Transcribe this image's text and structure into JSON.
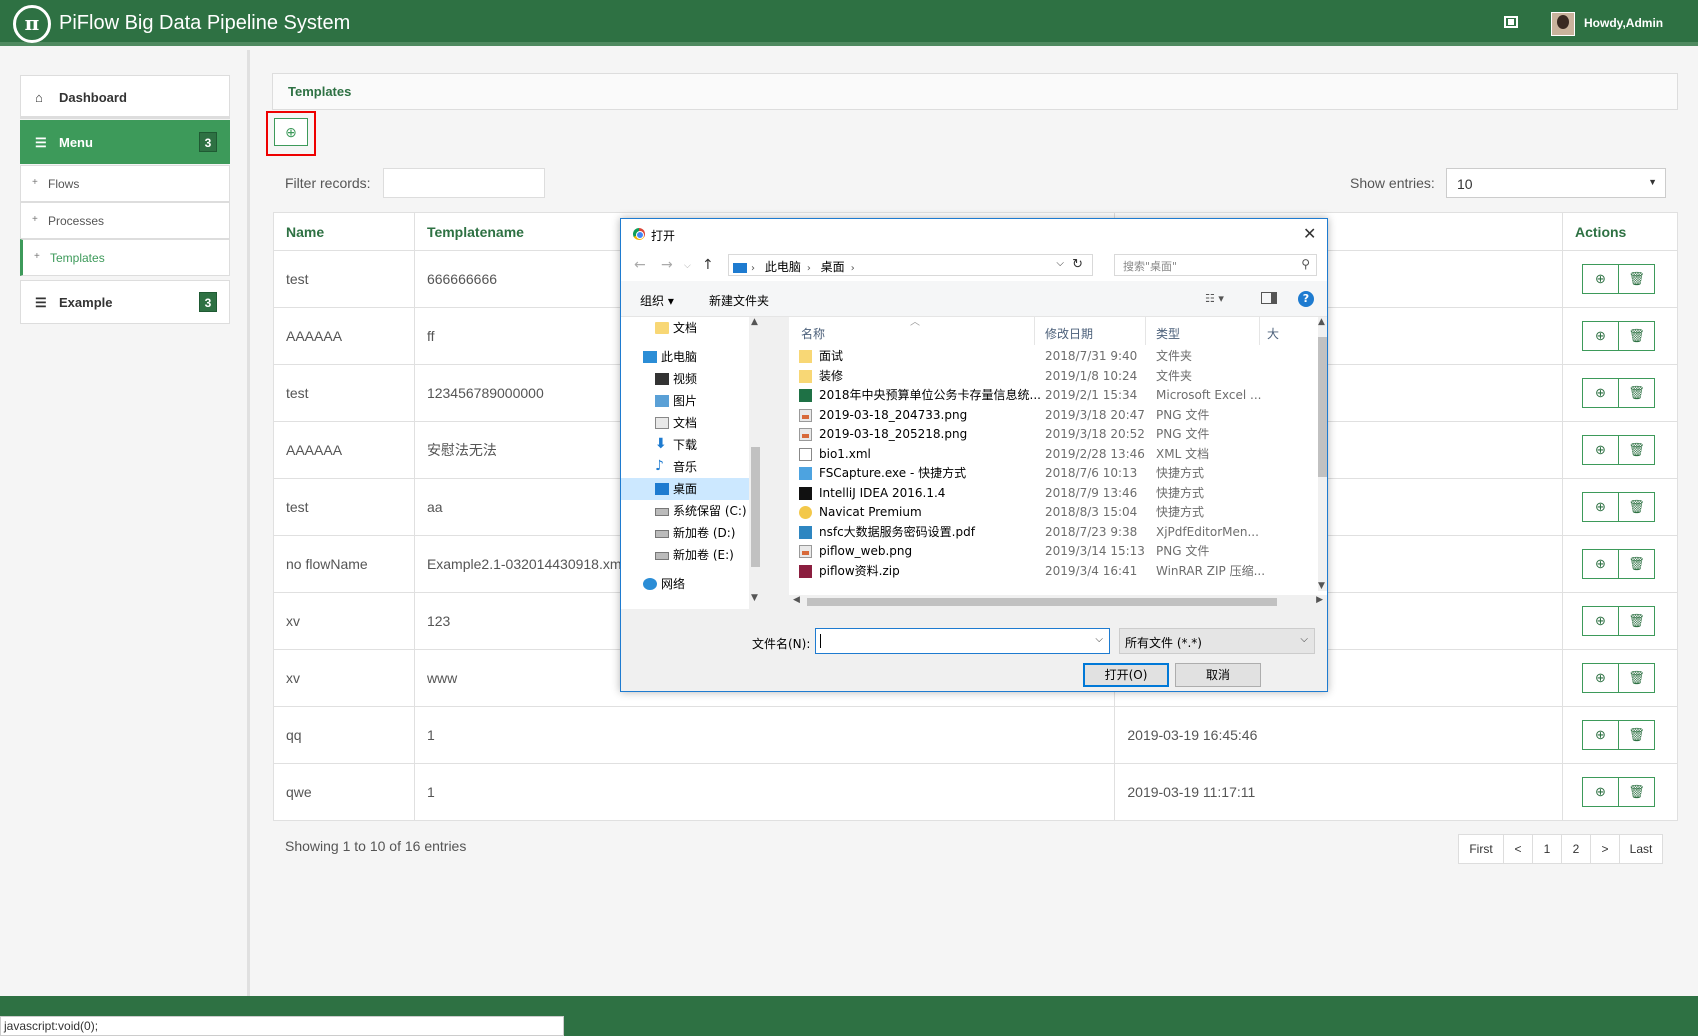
{
  "app": {
    "logo_text": "π",
    "title": "PiFlow Big Data Pipeline System",
    "user_greeting": "Howdy,Admin"
  },
  "sidebar": {
    "dashboard": "Dashboard",
    "menu": {
      "label": "Menu",
      "badge": "3"
    },
    "items": [
      {
        "label": "Flows"
      },
      {
        "label": "Processes"
      },
      {
        "label": "Templates",
        "active": true
      }
    ],
    "example": {
      "label": "Example",
      "badge": "3"
    }
  },
  "panel": {
    "title": "Templates",
    "filter_label": "Filter records:",
    "show_label": "Show entries:",
    "show_value": "10"
  },
  "table": {
    "headers": [
      "Name",
      "Templatename",
      "",
      "Actions"
    ],
    "rows": [
      {
        "name": "test",
        "templatename": "666666666",
        "date": ""
      },
      {
        "name": "AAAAAA",
        "templatename": "ff",
        "date": ""
      },
      {
        "name": "test",
        "templatename": "123456789000000",
        "date": ""
      },
      {
        "name": "AAAAAA",
        "templatename": "安慰法无法",
        "date": ""
      },
      {
        "name": "test",
        "templatename": "aa",
        "date": ""
      },
      {
        "name": "no flowName",
        "templatename": "Example2.1-032014430918.xml",
        "date": ""
      },
      {
        "name": "xv",
        "templatename": "123",
        "date": ""
      },
      {
        "name": "xv",
        "templatename": "www",
        "date": ""
      },
      {
        "name": "qq",
        "templatename": "1",
        "date": "2019-03-19 16:45:46"
      },
      {
        "name": "qwe",
        "templatename": "1",
        "date": "2019-03-19 11:17:11"
      }
    ],
    "showing": "Showing 1 to 10 of 16 entries",
    "pager": [
      "First",
      "<",
      "1",
      "2",
      ">",
      "Last"
    ]
  },
  "status_bar": "javascript:void(0);",
  "dialog": {
    "title": "打开",
    "breadcrumb": [
      "此电脑",
      "桌面"
    ],
    "search_placeholder": "搜索\"桌面\"",
    "organize": "组织 ▾",
    "new_folder": "新建文件夹",
    "tree": [
      {
        "label": "文档",
        "icon": "folder-icon",
        "indent": 1
      },
      {
        "label": "此电脑",
        "icon": "computer-icon",
        "indent": 0
      },
      {
        "label": "视频",
        "icon": "video-icon",
        "indent": 1
      },
      {
        "label": "图片",
        "icon": "pictures-icon",
        "indent": 1
      },
      {
        "label": "文档",
        "icon": "documents-icon",
        "indent": 1
      },
      {
        "label": "下载",
        "icon": "download-icon",
        "indent": 1
      },
      {
        "label": "音乐",
        "icon": "music-icon",
        "indent": 1
      },
      {
        "label": "桌面",
        "icon": "desktop-icon",
        "indent": 1,
        "selected": true
      },
      {
        "label": "系统保留 (C:)",
        "icon": "drive-icon",
        "indent": 1
      },
      {
        "label": "新加卷 (D:)",
        "icon": "drive-icon",
        "indent": 1
      },
      {
        "label": "新加卷 (E:)",
        "icon": "drive-icon",
        "indent": 1
      },
      {
        "label": "网络",
        "icon": "network-icon",
        "indent": 0
      }
    ],
    "columns": [
      "名称",
      "修改日期",
      "类型",
      "大"
    ],
    "files": [
      {
        "name": "面试",
        "date": "2018/7/31 9:40",
        "type": "文件夹",
        "icon": "fi-folder"
      },
      {
        "name": "装修",
        "date": "2019/1/8 10:24",
        "type": "文件夹",
        "icon": "fi-folder"
      },
      {
        "name": "2018年中央预算单位公务卡存量信息统...",
        "date": "2019/2/1 15:34",
        "type": "Microsoft Excel ...",
        "icon": "fi-excel"
      },
      {
        "name": "2019-03-18_204733.png",
        "date": "2019/3/18 20:47",
        "type": "PNG 文件",
        "icon": "fi-png"
      },
      {
        "name": "2019-03-18_205218.png",
        "date": "2019/3/18 20:52",
        "type": "PNG 文件",
        "icon": "fi-png"
      },
      {
        "name": "bio1.xml",
        "date": "2019/2/28 13:46",
        "type": "XML 文档",
        "icon": "fi-xml"
      },
      {
        "name": "FSCapture.exe - 快捷方式",
        "date": "2018/7/6 10:13",
        "type": "快捷方式",
        "icon": "fi-fs"
      },
      {
        "name": "IntelliJ IDEA 2016.1.4",
        "date": "2018/7/9 13:46",
        "type": "快捷方式",
        "icon": "fi-idea"
      },
      {
        "name": "Navicat Premium",
        "date": "2018/8/3 15:04",
        "type": "快捷方式",
        "icon": "fi-navicat"
      },
      {
        "name": "nsfc大数据服务密码设置.pdf",
        "date": "2018/7/23 9:38",
        "type": "XjPdfEditorMen...",
        "icon": "fi-pdf"
      },
      {
        "name": "piflow_web.png",
        "date": "2019/3/14 15:13",
        "type": "PNG 文件",
        "icon": "fi-png"
      },
      {
        "name": "piflow资料.zip",
        "date": "2019/3/4 16:41",
        "type": "WinRAR ZIP 压缩...",
        "icon": "fi-zip"
      }
    ],
    "filename_label": "文件名(N):",
    "filename_value": "",
    "filetype": "所有文件 (*.*)",
    "open_button": "打开(O)",
    "cancel_button": "取消"
  }
}
